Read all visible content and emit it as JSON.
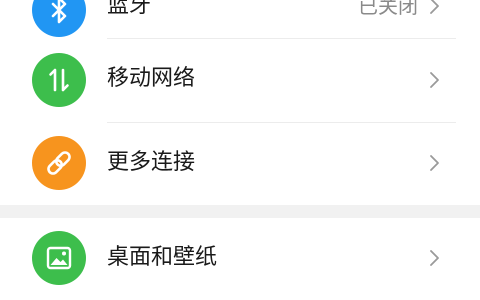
{
  "settings": {
    "rows": [
      {
        "icon": "bluetooth-icon",
        "color": "#2196F3",
        "label": "蓝牙",
        "value": "已关闭"
      },
      {
        "icon": "mobile-data-icon",
        "color": "#3DBE4C",
        "label": "移动网络"
      },
      {
        "icon": "link-icon",
        "color": "#F7941E",
        "label": "更多连接"
      },
      {
        "icon": "wallpaper-icon",
        "color": "#3DBE4C",
        "label": "桌面和壁纸"
      }
    ]
  }
}
